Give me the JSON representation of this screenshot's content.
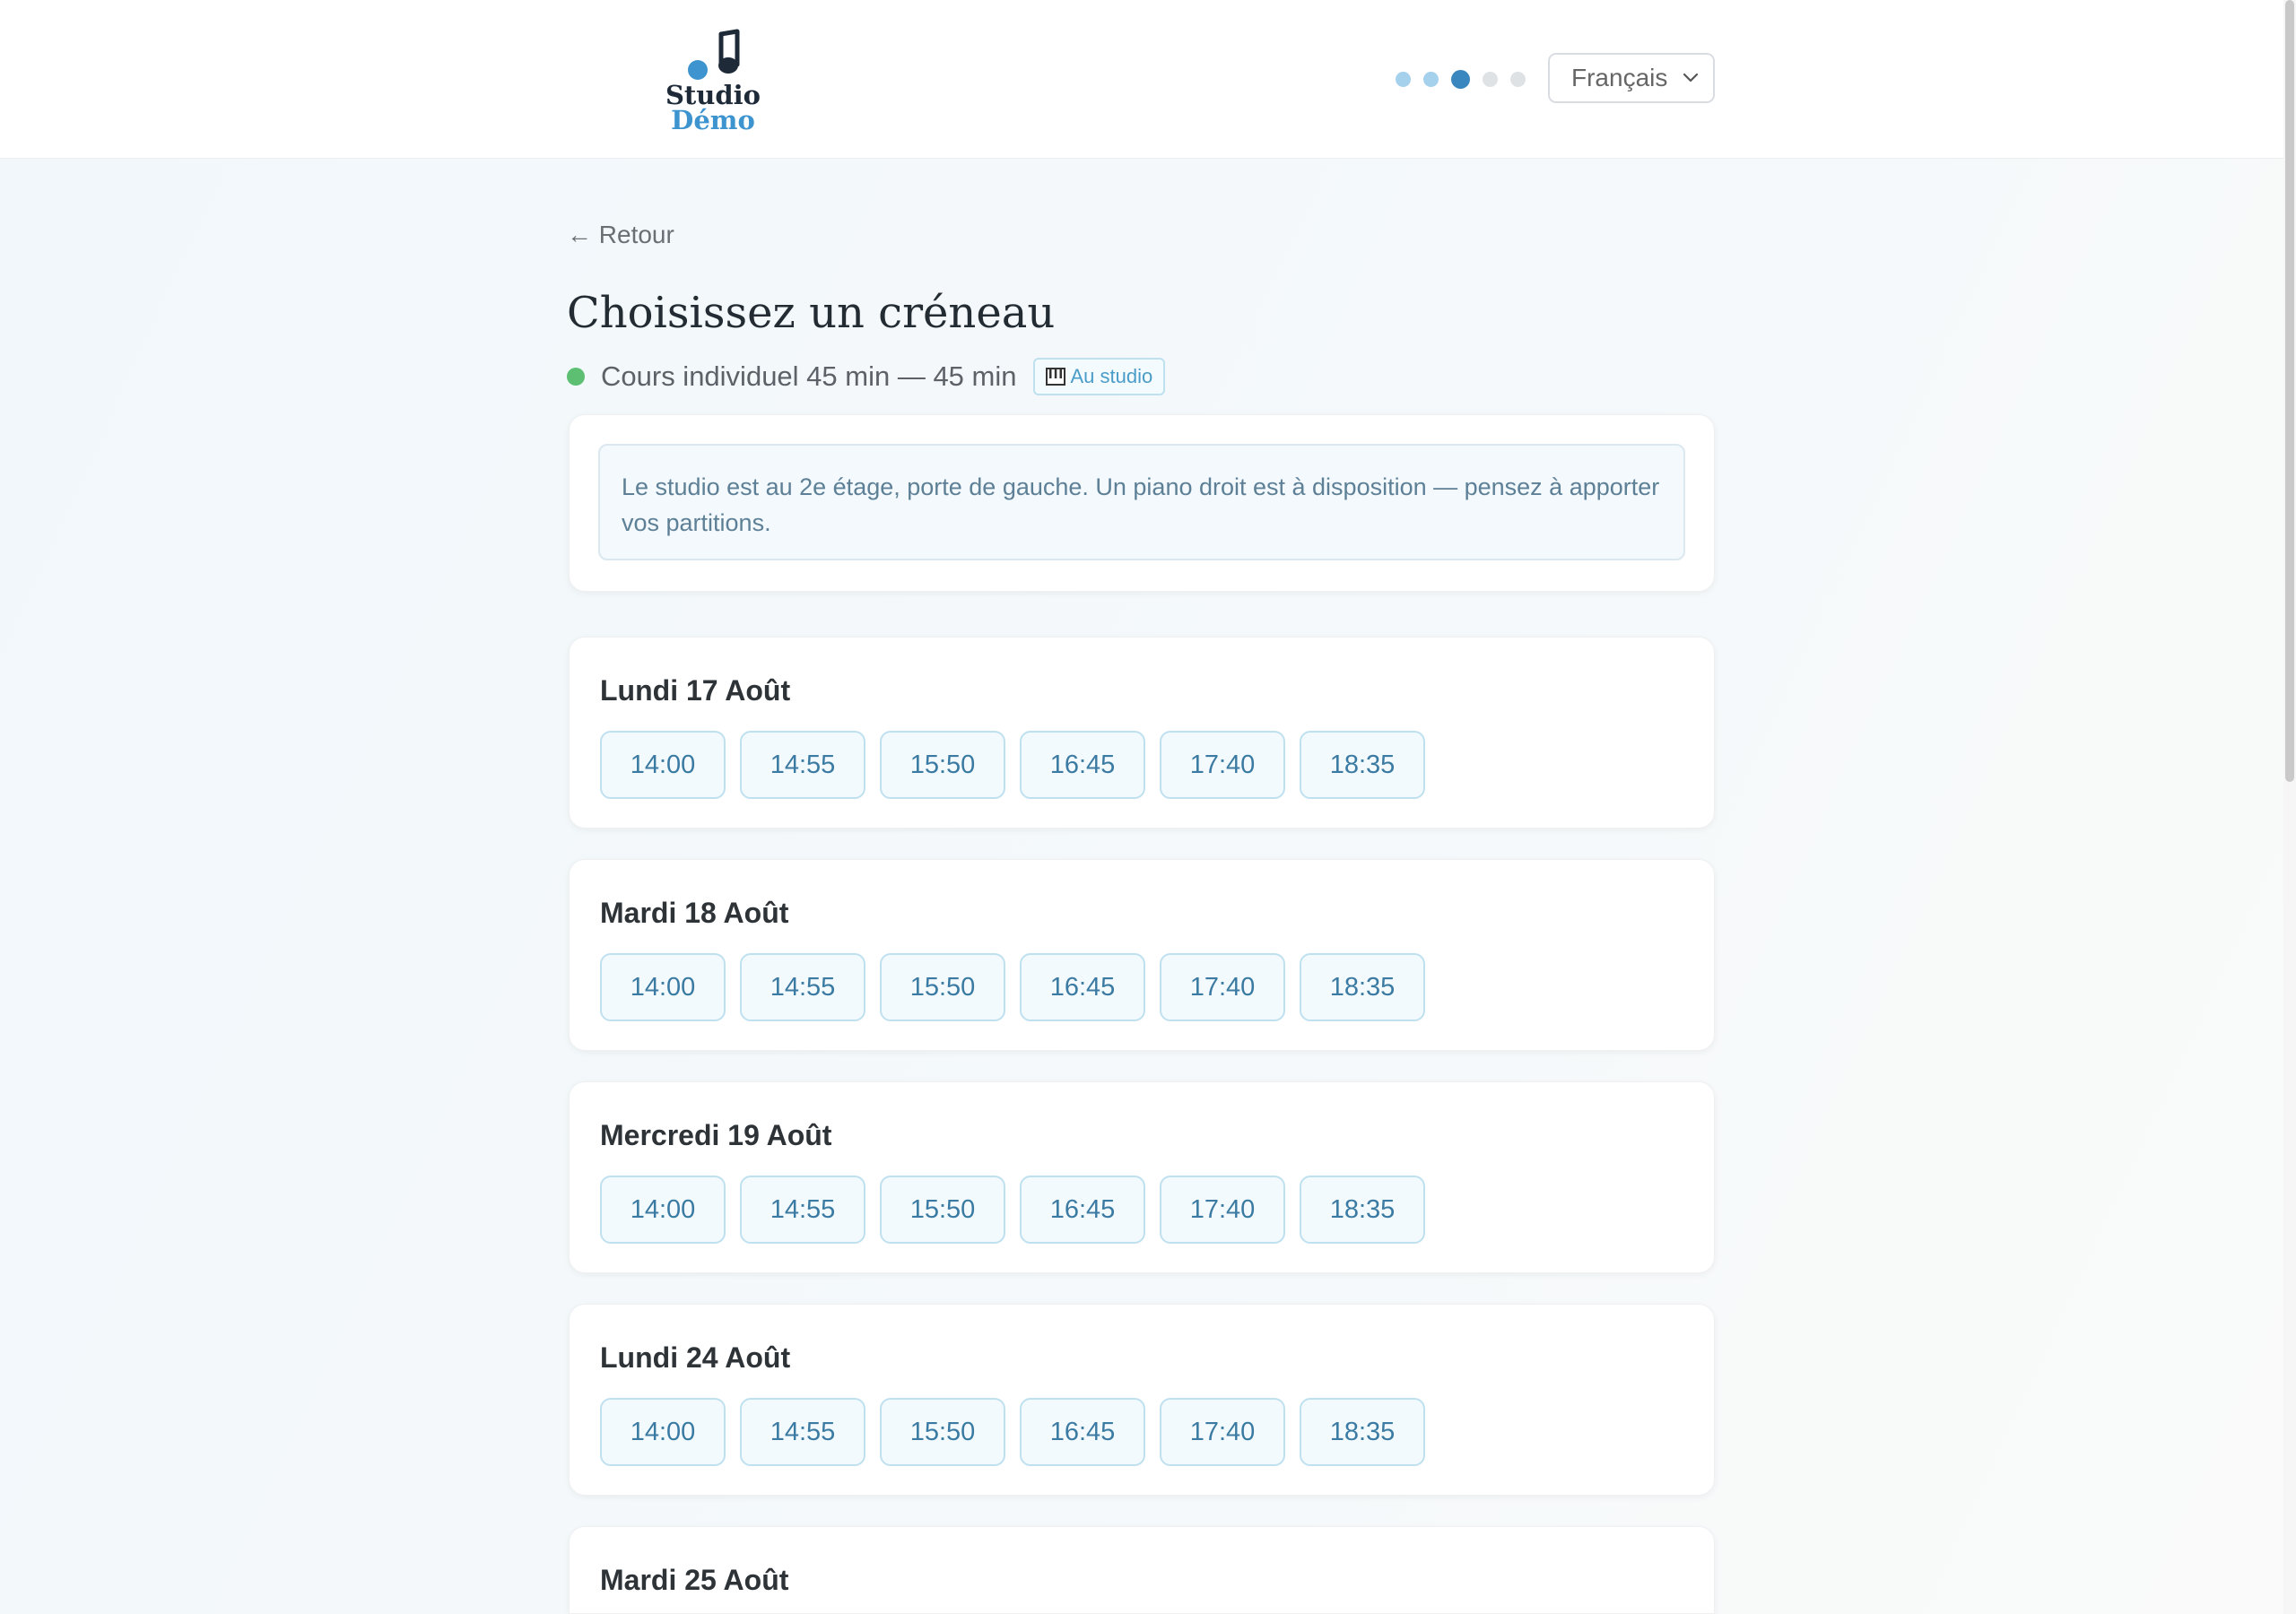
{
  "header": {
    "logo": {
      "line1": "Studio",
      "line2": "Démo",
      "icon": "music-note-icon"
    },
    "steps": {
      "total": 5,
      "current": 3
    },
    "language": {
      "selected": "Français"
    }
  },
  "nav": {
    "back_label": "← Retour"
  },
  "page": {
    "title": "Choisissez un créneau",
    "service": {
      "name": "Cours individuel 45 min — 45 min",
      "status_color": "#5cbf72",
      "badge_icon": "piano-icon",
      "badge_label": "Au studio"
    },
    "note": "Le studio est au 2e étage, porte de gauche. Un piano droit est à disposition — pensez à apporter vos partitions."
  },
  "days": [
    {
      "title": "Lundi 17 Août",
      "slots": [
        "14:00",
        "14:55",
        "15:50",
        "16:45",
        "17:40",
        "18:35"
      ]
    },
    {
      "title": "Mardi 18 Août",
      "slots": [
        "14:00",
        "14:55",
        "15:50",
        "16:45",
        "17:40",
        "18:35"
      ]
    },
    {
      "title": "Mercredi 19 Août",
      "slots": [
        "14:00",
        "14:55",
        "15:50",
        "16:45",
        "17:40",
        "18:35"
      ]
    },
    {
      "title": "Lundi 24 Août",
      "slots": [
        "14:00",
        "14:55",
        "15:50",
        "16:45",
        "17:40",
        "18:35"
      ]
    },
    {
      "title": "Mardi 25 Août",
      "slots": []
    }
  ],
  "colors": {
    "accent": "#3a86bf",
    "slot_text": "#3b7ba3",
    "slot_border": "#bfe0ef",
    "step_done": "#a5d1ec",
    "step_pending": "#dfe2e5"
  }
}
